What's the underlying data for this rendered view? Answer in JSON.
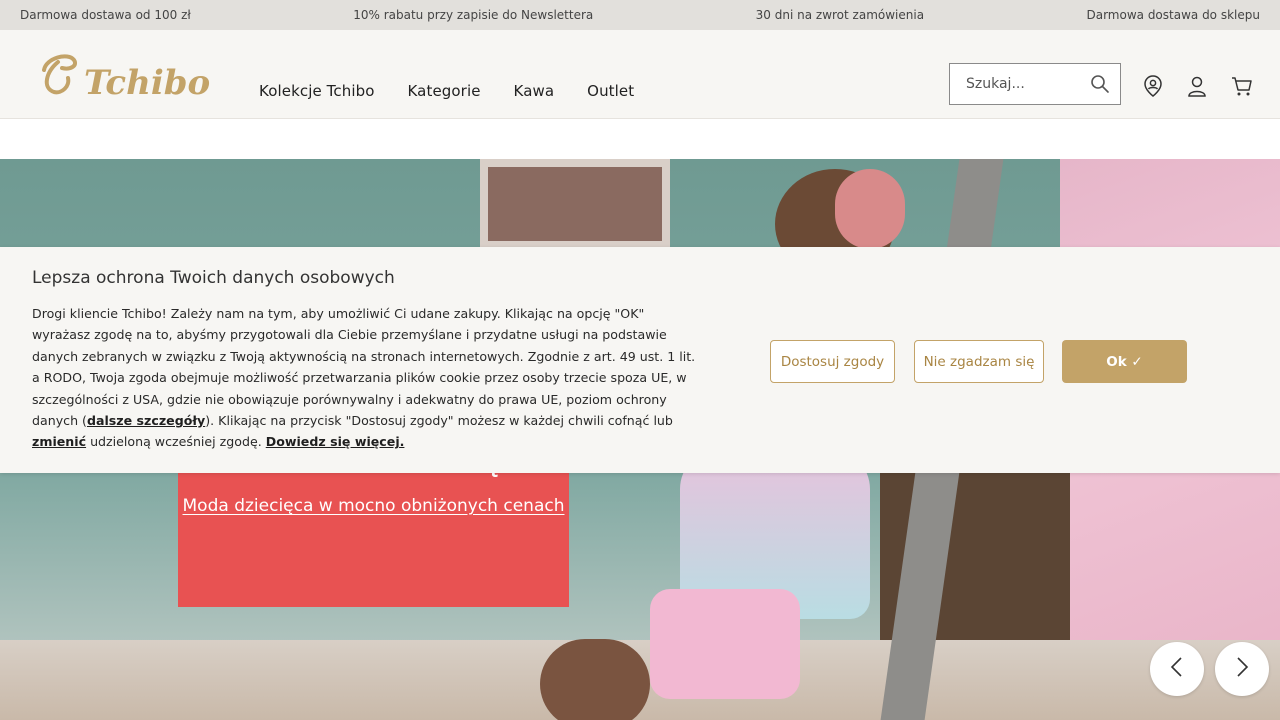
{
  "topbar": {
    "items": [
      "Darmowa dostawa od 100 zł",
      "10% rabatu przy zapisie do Newslettera",
      "30 dni na zwrot zamówienia",
      "Darmowa dostawa do sklepu"
    ]
  },
  "header": {
    "logo_text": "Tchibo",
    "nav": [
      "Kolekcje Tchibo",
      "Kategorie",
      "Kawa",
      "Outlet"
    ],
    "search": {
      "placeholder": "Szukaj..."
    },
    "icons": [
      "store-locator-icon",
      "account-icon",
      "cart-icon"
    ]
  },
  "hero": {
    "promo_title": "Dzieciaki z klasą",
    "promo_link": "Moda dziecięca w mocno obniżonych cenach",
    "promo_color": "#e85252",
    "prev_icon": "chevron-left-icon",
    "next_icon": "chevron-right-icon"
  },
  "cookie": {
    "title": "Lepsza ochrona Twoich danych osobowych",
    "text_1": "Drogi kliencie Tchibo! Zależy nam na tym, aby umożliwić Ci udane zakupy. Klikając na opcję \"OK\" wyrażasz zgodę na to, abyśmy przygotowali dla Ciebie przemyślane i przydatne usługi na podstawie danych zebranych w związku z Twoją aktywnością na stronach internetowych. Zgodnie z art. 49 ust. 1 lit. a RODO, Twoja zgoda obejmuje możliwość przetwarzania plików cookie przez osoby trzecie spoza UE, w szczególności z USA, gdzie nie obowiązuje porównywalny i adekwatny do prawa UE, poziom ochrony danych (",
    "link_details": "dalsze szczegóły",
    "text_2": "). Klikając na przycisk \"Dostosuj zgody\" możesz w każdej chwili cofnąć lub ",
    "link_change": "zmienić",
    "text_3": " udzieloną wcześniej zgodę. ",
    "link_more": "Dowiedz się więcej.",
    "buttons": {
      "customize": "Dostosuj zgody",
      "decline": "Nie zgadzam się",
      "ok": "Ok ✓"
    },
    "accent_color": "#c3a368"
  }
}
